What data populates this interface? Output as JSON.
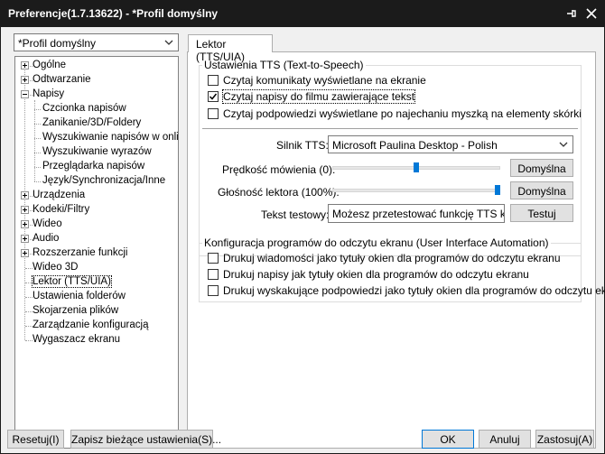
{
  "window": {
    "title": "Preferencje(1.7.13622) - *Profil domyślny"
  },
  "profile": {
    "selected": "*Profil domyślny"
  },
  "tree": {
    "items": [
      {
        "label": "Ogólne",
        "level": 0,
        "expander": "plus"
      },
      {
        "label": "Odtwarzanie",
        "level": 0,
        "expander": "plus"
      },
      {
        "label": "Napisy",
        "level": 0,
        "expander": "minus"
      },
      {
        "label": "Czcionka napisów",
        "level": 1
      },
      {
        "label": "Zanikanie/3D/Foldery",
        "level": 1
      },
      {
        "label": "Wyszukiwanie napisów w onli",
        "level": 1
      },
      {
        "label": "Wyszukiwanie wyrazów",
        "level": 1
      },
      {
        "label": "Przeglądarka napisów",
        "level": 1
      },
      {
        "label": "Język/Synchronizacja/Inne",
        "level": 1
      },
      {
        "label": "Urządzenia",
        "level": 0,
        "expander": "plus"
      },
      {
        "label": "Kodeki/Filtry",
        "level": 0,
        "expander": "plus"
      },
      {
        "label": "Wideo",
        "level": 0,
        "expander": "plus"
      },
      {
        "label": "Audio",
        "level": 0,
        "expander": "plus"
      },
      {
        "label": "Rozszerzanie funkcji",
        "level": 0,
        "expander": "plus"
      },
      {
        "label": "Wideo 3D",
        "level": 0
      },
      {
        "label": "Lektor (TTS/UIA)",
        "level": 0,
        "selected": true
      },
      {
        "label": "Ustawienia folderów",
        "level": 0
      },
      {
        "label": "Skojarzenia plików",
        "level": 0
      },
      {
        "label": "Zarządzanie konfiguracją",
        "level": 0
      },
      {
        "label": "Wygaszacz ekranu",
        "level": 0
      }
    ]
  },
  "tab": {
    "label": "Lektor (TTS/UIA)"
  },
  "tts": {
    "group_title": "Ustawienia TTS (Text-to-Speech)",
    "checkboxes": [
      {
        "label": "Czytaj komunikaty wyświetlane na ekranie",
        "checked": false
      },
      {
        "label": "Czytaj napisy do filmu zawierające tekst",
        "checked": true
      },
      {
        "label": "Czytaj podpowiedzi wyświetlane po najechaniu myszką na elementy skórki",
        "checked": false
      }
    ],
    "engine_label": "Silnik TTS:",
    "engine_value": "Microsoft Paulina Desktop - Polish",
    "speed_label": "Prędkość mówienia (0):",
    "speed_fraction": 0.5,
    "speed_default": "Domyślna",
    "volume_label": "Głośność lektora (100%):",
    "volume_fraction": 1.0,
    "volume_default": "Domyślna",
    "test_label": "Tekst testowy:",
    "test_value": "Możesz przetestować funkcję TTS klikając",
    "test_button": "Testuj"
  },
  "uia": {
    "group_title": "Konfiguracja programów do odczytu ekranu (User Interface Automation)",
    "checkboxes": [
      {
        "label": "Drukuj wiadomości jako tytuły okien dla programów do odczytu ekranu",
        "checked": false
      },
      {
        "label": "Drukuj napisy jak tytuły okien dla programów do odczytu ekranu",
        "checked": false
      },
      {
        "label": "Drukuj wyskakujące podpowiedzi jako tytuły okien dla programów do odczytu ek...",
        "checked": false
      }
    ]
  },
  "footer": {
    "reset": "Resetuj(I)",
    "save": "Zapisz bieżące ustawienia(S)...",
    "ok": "OK",
    "cancel": "Anuluj",
    "apply": "Zastosuj(A)"
  },
  "colors": {
    "accent": "#0078d7",
    "titlebar": "#1b1b1b"
  }
}
